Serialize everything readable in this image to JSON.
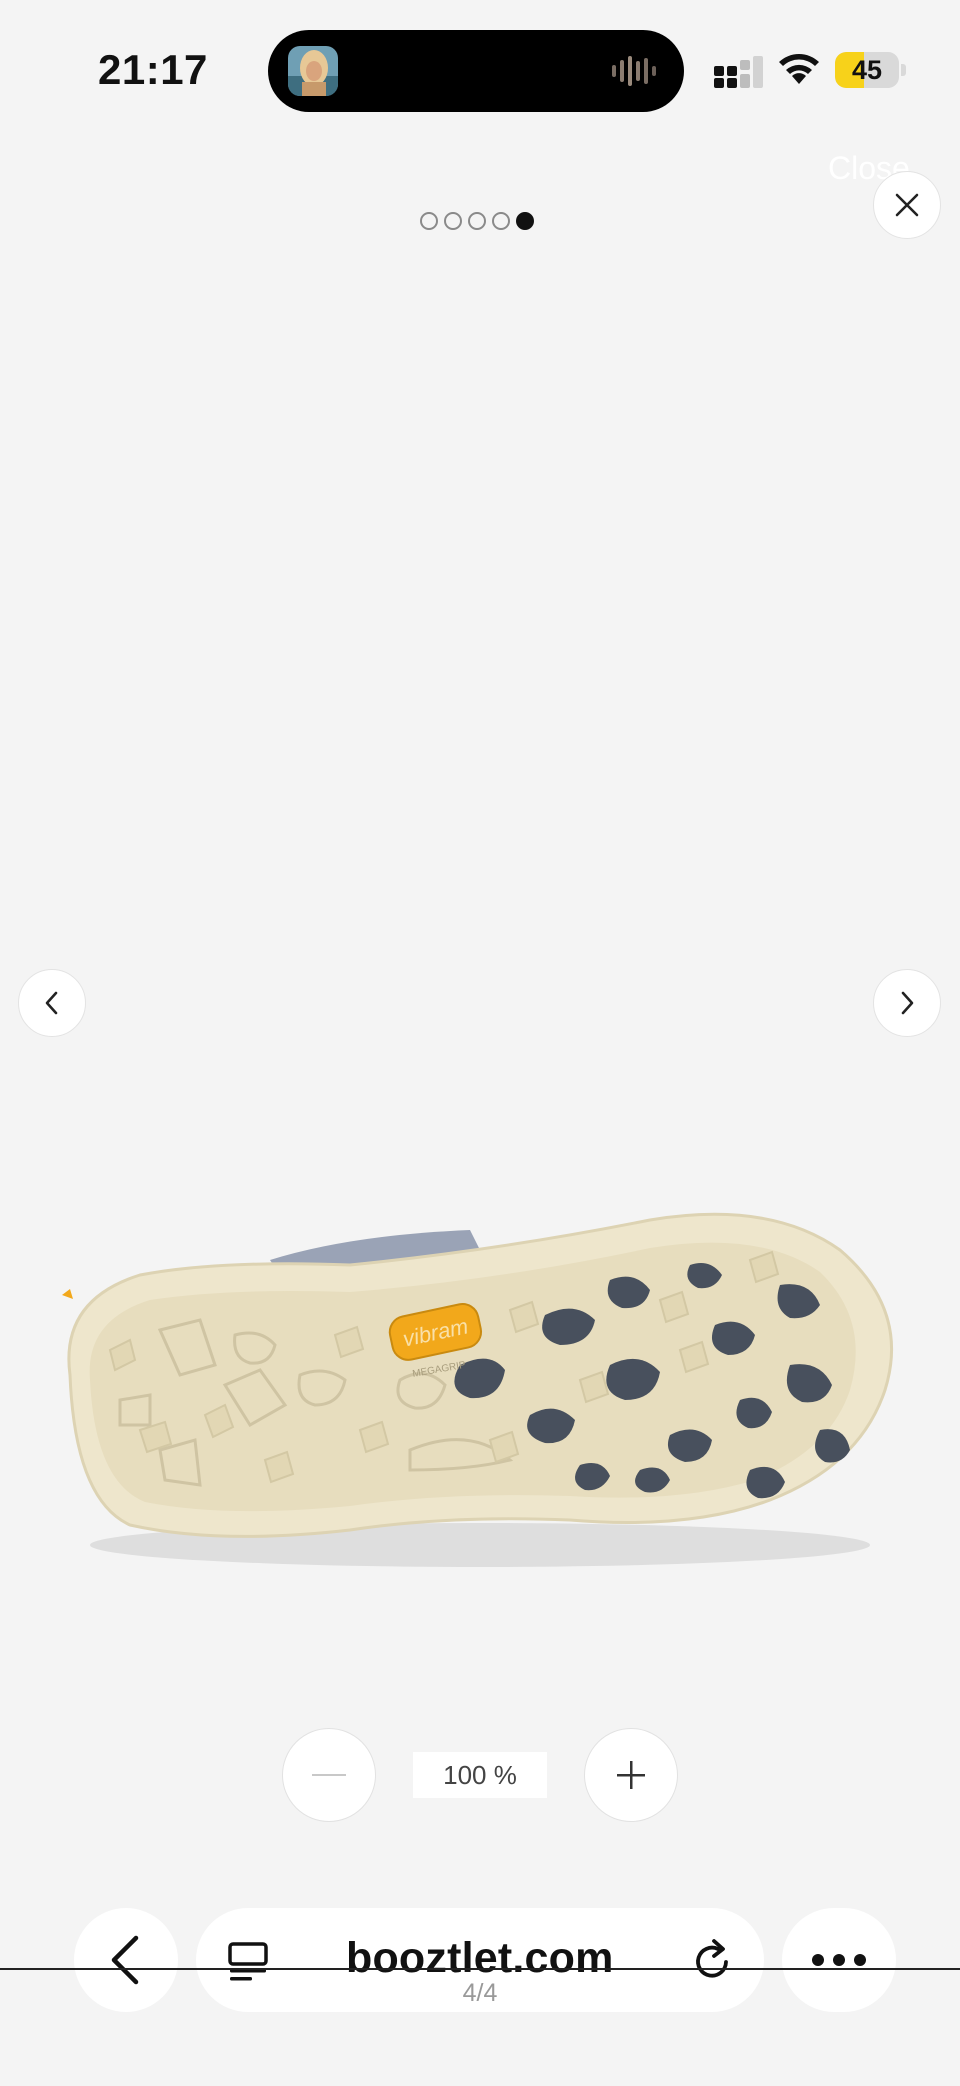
{
  "status_bar": {
    "time": "21:17",
    "battery_level": 45,
    "battery_text": "45",
    "battery_color": "#f7d21a"
  },
  "viewer": {
    "close_label": "Close",
    "close_icon": "close-icon",
    "pager": {
      "total": 5,
      "active_index": 4
    },
    "prev_icon": "chevron-left-icon",
    "next_icon": "chevron-right-icon",
    "image": {
      "brand_mark": "vibram",
      "sub_mark": "MEGAGRIP",
      "sole_color": "#eee6cc",
      "lug_color": "#48505d",
      "logo_color": "#f2a81b"
    },
    "zoom": {
      "minus_icon": "minus-icon",
      "plus_icon": "plus-icon",
      "level": "100 %"
    },
    "counter": "4/4"
  },
  "browser": {
    "back_icon": "chevron-left-icon",
    "tabs_icon": "tabs-icon",
    "url": "booztlet.com",
    "reload_icon": "reload-icon",
    "more_icon": "more-icon"
  }
}
